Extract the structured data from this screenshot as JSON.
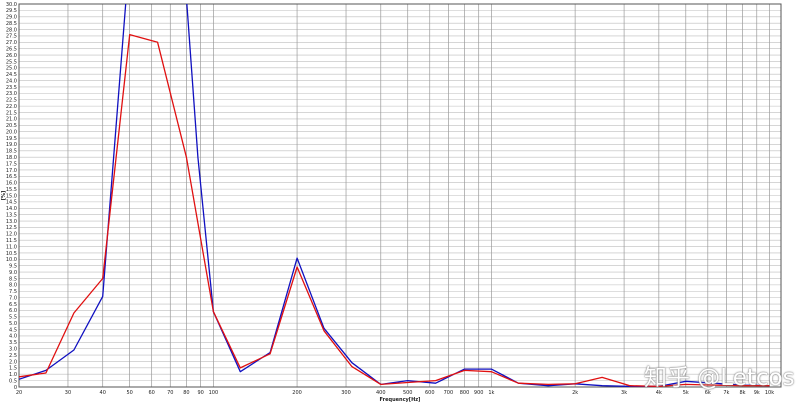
{
  "chart_data": {
    "type": "line",
    "xlabel": "Frequency[Hz]",
    "ylabel": "[%]",
    "xscale": "log",
    "xlim": [
      20,
      11000
    ],
    "ylim": [
      0,
      30
    ],
    "grid": true,
    "y_ticks": [
      "0",
      "0.5",
      "1.0",
      "1.5",
      "2.0",
      "2.5",
      "3.0",
      "3.5",
      "4.0",
      "4.5",
      "5.0",
      "5.5",
      "6.0",
      "6.5",
      "7.0",
      "7.5",
      "8.0",
      "8.5",
      "9.0",
      "9.5",
      "10.0",
      "10.5",
      "11.0",
      "11.5",
      "12.0",
      "12.5",
      "13.0",
      "13.5",
      "14.0",
      "14.5",
      "15.0",
      "15.5",
      "16.0",
      "16.5",
      "17.0",
      "17.5",
      "18.0",
      "18.5",
      "19.0",
      "19.5",
      "20.0",
      "20.5",
      "21.0",
      "21.5",
      "22.0",
      "22.5",
      "23.0",
      "23.5",
      "24.0",
      "24.5",
      "25.0",
      "25.5",
      "26.0",
      "26.5",
      "27.0",
      "27.5",
      "28.0",
      "28.5",
      "29.0",
      "29.5",
      "30.0"
    ],
    "x_ticks": [
      {
        "v": 20,
        "label": "20"
      },
      {
        "v": 30,
        "label": "30"
      },
      {
        "v": 40,
        "label": "40"
      },
      {
        "v": 50,
        "label": "50"
      },
      {
        "v": 60,
        "label": "60"
      },
      {
        "v": 70,
        "label": "70"
      },
      {
        "v": 80,
        "label": "80"
      },
      {
        "v": 90,
        "label": "90"
      },
      {
        "v": 100,
        "label": "100"
      },
      {
        "v": 200,
        "label": "200"
      },
      {
        "v": 300,
        "label": "300"
      },
      {
        "v": 400,
        "label": "400"
      },
      {
        "v": 500,
        "label": "500"
      },
      {
        "v": 600,
        "label": "600"
      },
      {
        "v": 700,
        "label": "700"
      },
      {
        "v": 800,
        "label": "800"
      },
      {
        "v": 900,
        "label": "900"
      },
      {
        "v": 1000,
        "label": "1k"
      },
      {
        "v": 2000,
        "label": "2k"
      },
      {
        "v": 3000,
        "label": "3k"
      },
      {
        "v": 4000,
        "label": "4k"
      },
      {
        "v": 5000,
        "label": "5k"
      },
      {
        "v": 6000,
        "label": "6k"
      },
      {
        "v": 7000,
        "label": "7k"
      },
      {
        "v": 8000,
        "label": "8k"
      },
      {
        "v": 9000,
        "label": "9k"
      },
      {
        "v": 10000,
        "label": "10k"
      }
    ],
    "series": [
      {
        "color": "#1010c0",
        "points": [
          [
            20,
            0.6
          ],
          [
            25,
            1.3
          ],
          [
            31.5,
            2.9
          ],
          [
            40,
            7.1
          ],
          [
            50,
            34
          ],
          [
            80,
            30.5
          ],
          [
            88,
            18
          ],
          [
            100,
            5.9
          ],
          [
            125,
            1.2
          ],
          [
            160,
            2.7
          ],
          [
            200,
            10.1
          ],
          [
            250,
            4.6
          ],
          [
            315,
            1.9
          ],
          [
            400,
            0.2
          ],
          [
            500,
            0.5
          ],
          [
            630,
            0.3
          ],
          [
            800,
            1.4
          ],
          [
            1000,
            1.4
          ],
          [
            1250,
            0.3
          ],
          [
            1600,
            0.1
          ],
          [
            2000,
            0.25
          ],
          [
            2500,
            0.1
          ],
          [
            3150,
            0.05
          ],
          [
            4000,
            0.05
          ],
          [
            5000,
            0.45
          ],
          [
            6300,
            0.3
          ],
          [
            8000,
            0.15
          ],
          [
            10000,
            0.1
          ]
        ]
      },
      {
        "color": "#e01010",
        "points": [
          [
            20,
            0.8
          ],
          [
            25,
            1.1
          ],
          [
            31.5,
            5.8
          ],
          [
            40,
            8.5
          ],
          [
            50,
            27.6
          ],
          [
            63,
            27.0
          ],
          [
            80,
            18.0
          ],
          [
            100,
            5.9
          ],
          [
            125,
            1.5
          ],
          [
            160,
            2.6
          ],
          [
            200,
            9.4
          ],
          [
            250,
            4.4
          ],
          [
            315,
            1.6
          ],
          [
            400,
            0.2
          ],
          [
            500,
            0.35
          ],
          [
            630,
            0.5
          ],
          [
            800,
            1.3
          ],
          [
            1000,
            1.2
          ],
          [
            1250,
            0.3
          ],
          [
            1600,
            0.2
          ],
          [
            2000,
            0.25
          ],
          [
            2500,
            0.75
          ],
          [
            3150,
            0.1
          ],
          [
            4000,
            0.05
          ],
          [
            5000,
            0.2
          ],
          [
            6300,
            0.15
          ],
          [
            8000,
            0.1
          ],
          [
            10000,
            0.1
          ]
        ]
      }
    ]
  },
  "watermark": "知乎 @Letcos"
}
